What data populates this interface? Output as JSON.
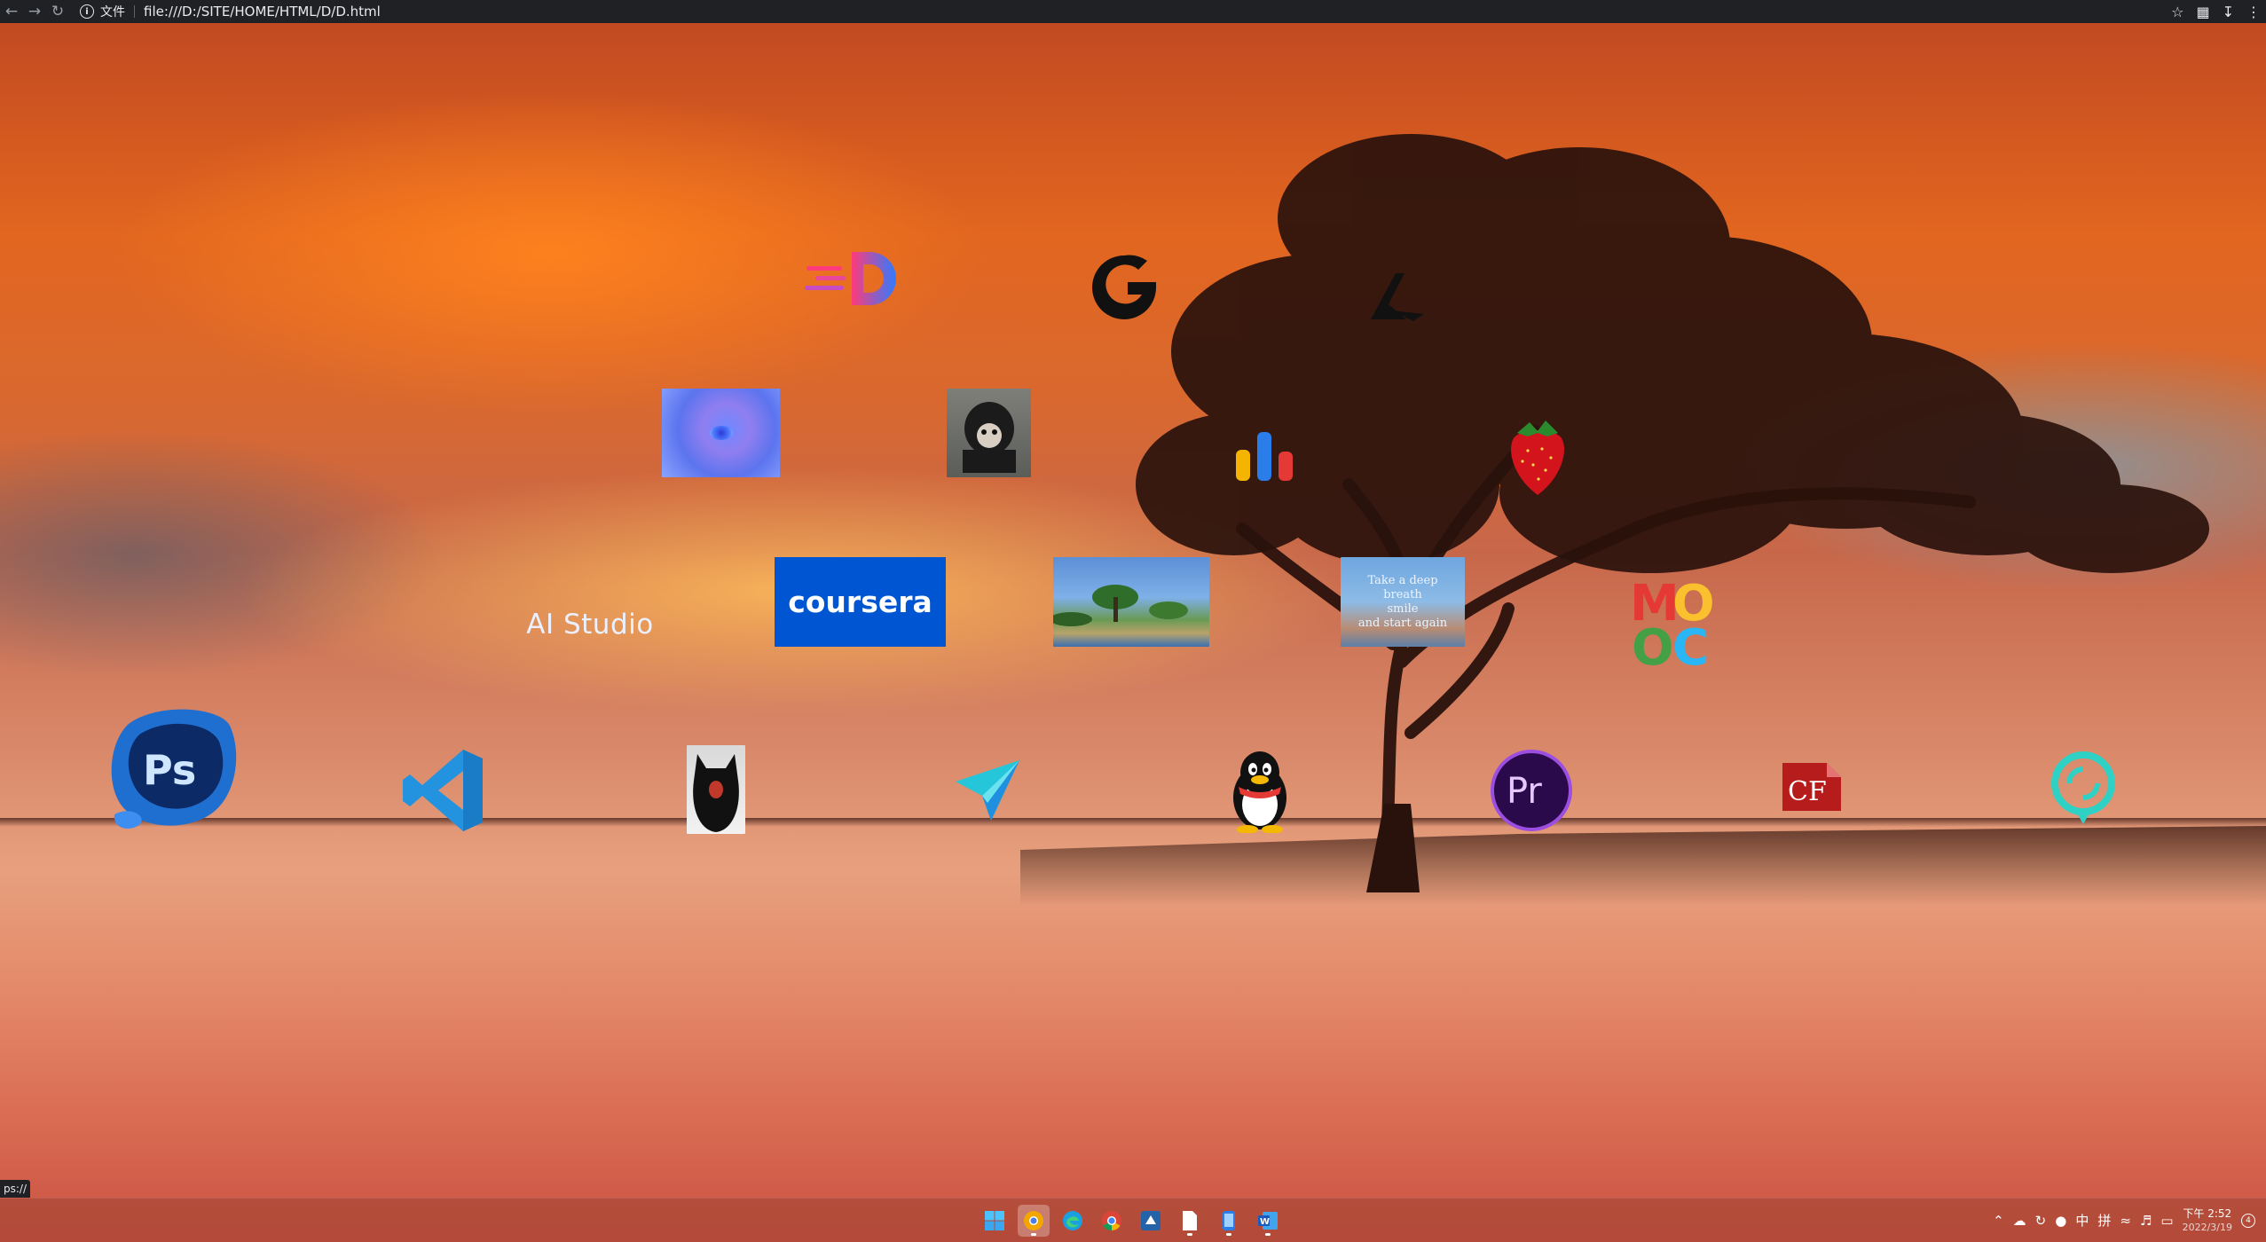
{
  "browser": {
    "back_icon": "arrow-left",
    "forward_icon": "arrow-right",
    "reload_icon": "reload",
    "file_label": "文件",
    "url": "file:///D:/SITE/HOME/HTML/D/D.html",
    "status_url": "ps://"
  },
  "desktop": {
    "row1": [
      "dribbble-d-logo",
      "logitech-g-logo",
      "aria-lambda-logo"
    ],
    "row2": [
      "blue-abstract-thumbnail",
      "monkey-photo",
      "bar-chart-logo",
      "strawberry-logo"
    ],
    "ai_studio_label": "AI Studio",
    "coursera_label": "coursera",
    "landscape_thumb": "landscape-photo",
    "quote_lines": [
      "Take a deep",
      "breath",
      "smile",
      "and start again"
    ],
    "mooc_letters": [
      "M",
      "O",
      "O",
      "C"
    ],
    "row4": [
      "photoshop",
      "vscode",
      "black-cat-photo",
      "paper-plane",
      "qq-penguin",
      "premiere-pro",
      "coldfusion",
      "cyan-circle-app"
    ],
    "ps_label": "Ps",
    "pr_label": "Pr",
    "cf_label": "CF"
  },
  "taskbar": {
    "apps": [
      "windows-start",
      "chrome-canary",
      "edge",
      "chrome",
      "visual-studio-installer",
      "file",
      "phone-link",
      "word"
    ],
    "tray_ime_zh": "中",
    "tray_ime_pin": "拼",
    "clock_time": "下午 2:52",
    "clock_date": "2022/3/19"
  },
  "colors": {
    "topbar": "#202124",
    "coursera": "#0056d2",
    "premiere": "#2a0a4a",
    "cyan_ring": "#2fd1c5"
  }
}
